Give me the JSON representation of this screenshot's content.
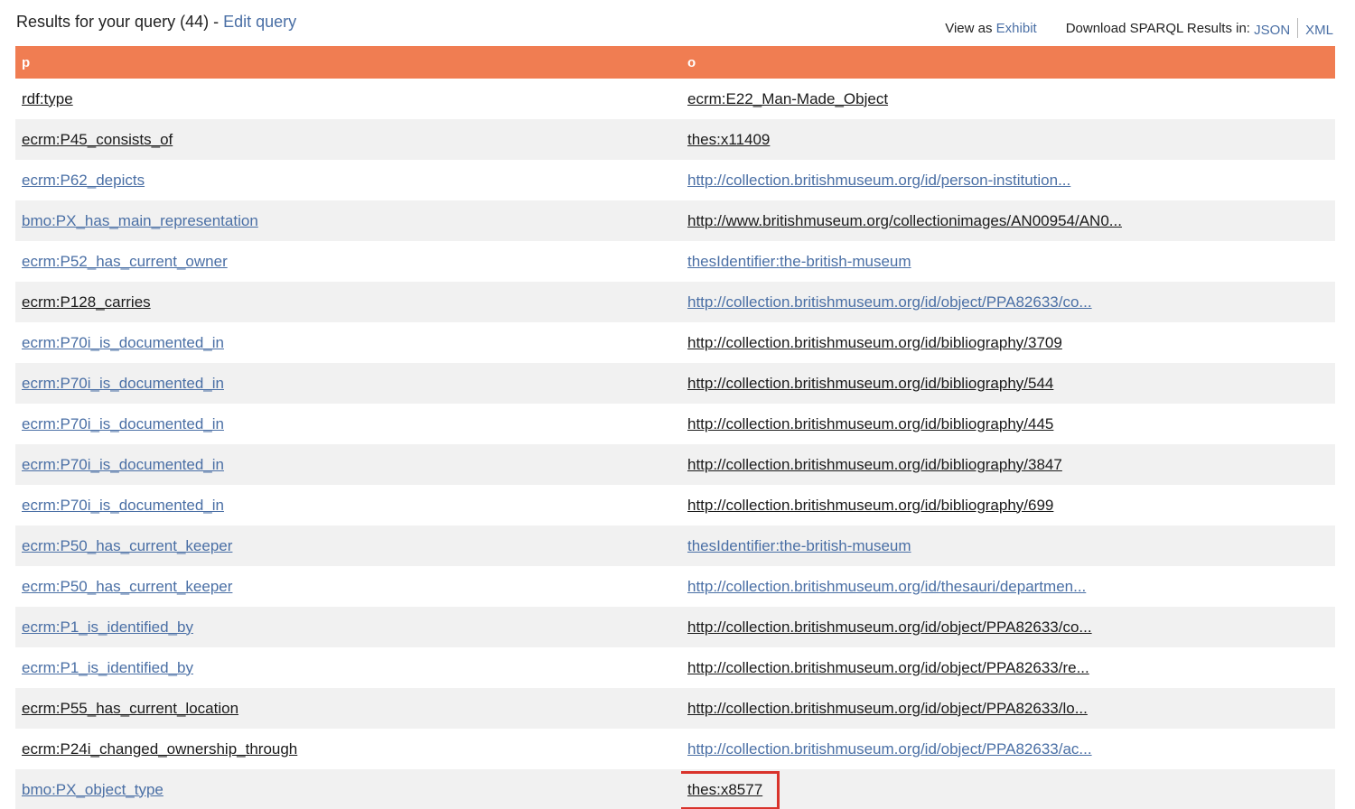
{
  "header": {
    "results_prefix": "Results for your query (44) - ",
    "edit_query": "Edit query",
    "view_as": "View as ",
    "exhibit": "Exhibit",
    "download_label": "Download SPARQL Results in: ",
    "json": "JSON",
    "xml": "XML"
  },
  "table": {
    "columns": [
      "p",
      "o"
    ],
    "rows": [
      {
        "p": "rdf:type",
        "o": "ecrm:E22_Man-Made_Object"
      },
      {
        "p": "ecrm:P45_consists_of",
        "o": "thes:x11409"
      },
      {
        "p": "ecrm:P62_depicts",
        "o": "http://collection.britishmuseum.org/id/person-institution..."
      },
      {
        "p": "bmo:PX_has_main_representation",
        "o": "http://www.britishmuseum.org/collectionimages/AN00954/AN0..."
      },
      {
        "p": "ecrm:P52_has_current_owner",
        "o": "thesIdentifier:the-british-museum"
      },
      {
        "p": "ecrm:P128_carries",
        "o": "http://collection.britishmuseum.org/id/object/PPA82633/co..."
      },
      {
        "p": "ecrm:P70i_is_documented_in",
        "o": "http://collection.britishmuseum.org/id/bibliography/3709"
      },
      {
        "p": "ecrm:P70i_is_documented_in",
        "o": "http://collection.britishmuseum.org/id/bibliography/544"
      },
      {
        "p": "ecrm:P70i_is_documented_in",
        "o": "http://collection.britishmuseum.org/id/bibliography/445"
      },
      {
        "p": "ecrm:P70i_is_documented_in",
        "o": "http://collection.britishmuseum.org/id/bibliography/3847"
      },
      {
        "p": "ecrm:P70i_is_documented_in",
        "o": "http://collection.britishmuseum.org/id/bibliography/699"
      },
      {
        "p": "ecrm:P50_has_current_keeper",
        "o": "thesIdentifier:the-british-museum"
      },
      {
        "p": "ecrm:P50_has_current_keeper",
        "o": "http://collection.britishmuseum.org/id/thesauri/departmen..."
      },
      {
        "p": "ecrm:P1_is_identified_by",
        "o": "http://collection.britishmuseum.org/id/object/PPA82633/co..."
      },
      {
        "p": "ecrm:P1_is_identified_by",
        "o": "http://collection.britishmuseum.org/id/object/PPA82633/re..."
      },
      {
        "p": "ecrm:P55_has_current_location",
        "o": "http://collection.britishmuseum.org/id/object/PPA82633/lo..."
      },
      {
        "p": "ecrm:P24i_changed_ownership_through",
        "o": "http://collection.britishmuseum.org/id/object/PPA82633/ac..."
      },
      {
        "p": "bmo:PX_object_type",
        "o": "thes:x8577"
      }
    ]
  },
  "colors": {
    "header_bg": "#f07d52",
    "link": "#4a6fa5",
    "visited_link": "#1a1a1a",
    "highlight": "#d9332b"
  }
}
